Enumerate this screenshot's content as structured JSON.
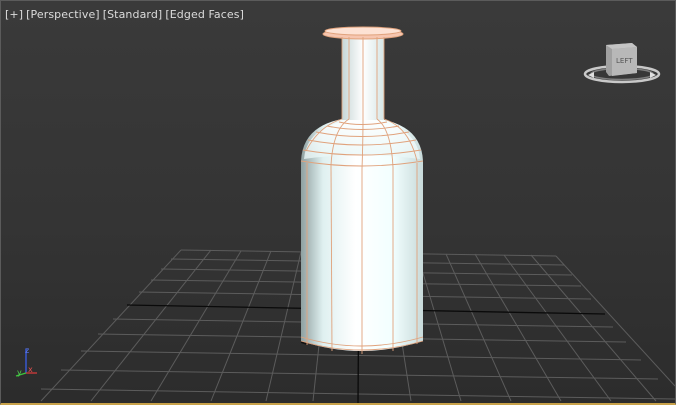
{
  "viewport": {
    "menu": {
      "plus": "[+]",
      "view": "[Perspective]",
      "shading": "[Standard]",
      "display": "[Edged Faces]"
    },
    "viewcube": {
      "face_label": "LEFT"
    },
    "axis_tripod": {
      "z": "z",
      "x": "x",
      "y": "y"
    },
    "colors": {
      "background": "#353535",
      "grid": "#5a5a5a",
      "grid_axis": "#0a0a0a",
      "bottle_edges": "#e0a27c",
      "border_active": "#c8a24a"
    }
  }
}
